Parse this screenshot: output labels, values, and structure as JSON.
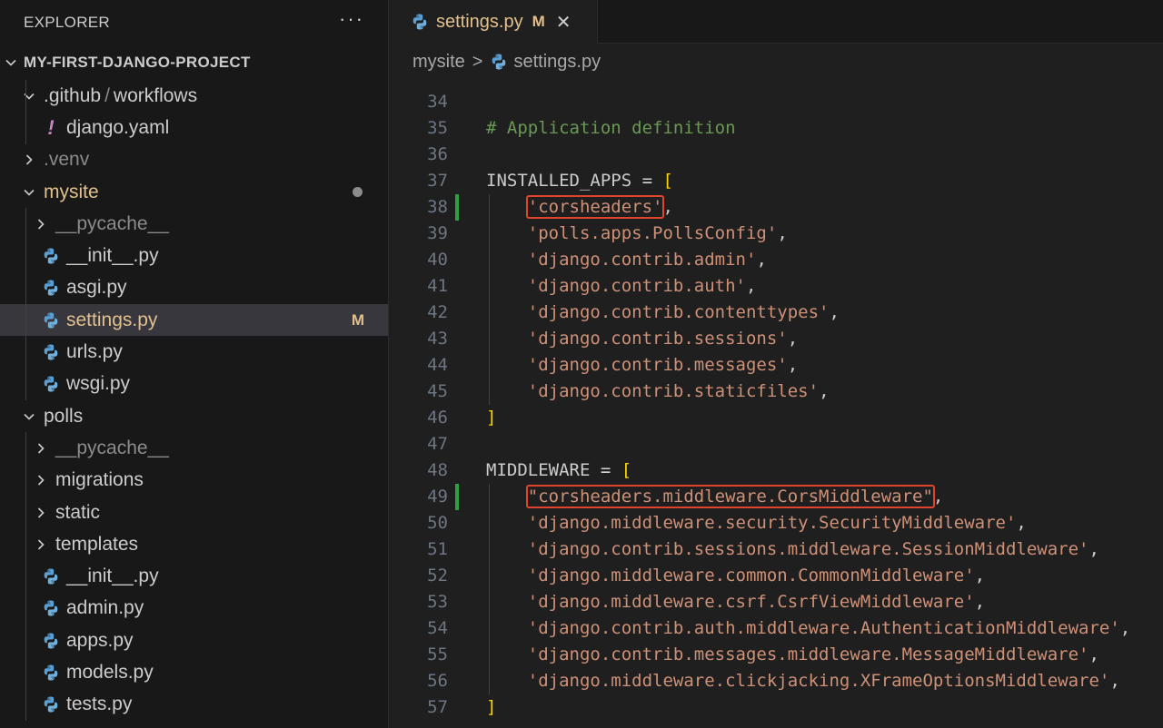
{
  "explorer": {
    "title": "EXPLORER",
    "more": "···",
    "project": "MY-FIRST-DJANGO-PROJECT",
    "tree": [
      {
        "label": "<span data-name='github-folder-label'>.github</span>",
        "kind": "folder",
        "open": true,
        "depth": 0,
        "name": "github-folder",
        "compact": [
          "workflows"
        ]
      },
      {
        "label": "django.yaml",
        "kind": "yaml",
        "depth": 1,
        "name": "django-yaml"
      },
      {
        "label": ".venv",
        "kind": "folder",
        "open": false,
        "depth": 0,
        "name": "venv-folder",
        "dim": true
      },
      {
        "label": "mysite",
        "kind": "folder",
        "open": true,
        "depth": 0,
        "name": "mysite-folder",
        "mod": true,
        "dot": true
      },
      {
        "label": "__pycache__",
        "kind": "folder",
        "open": false,
        "depth": 1,
        "name": "mysite-pycache",
        "dim": true
      },
      {
        "label": "__init__.py",
        "kind": "py",
        "depth": 1,
        "name": "mysite-init"
      },
      {
        "label": "asgi.py",
        "kind": "py",
        "depth": 1,
        "name": "asgi"
      },
      {
        "label": "settings.py",
        "kind": "py",
        "depth": 1,
        "name": "settings",
        "mod": true,
        "badge": "M",
        "selected": true
      },
      {
        "label": "urls.py",
        "kind": "py",
        "depth": 1,
        "name": "urls"
      },
      {
        "label": "wsgi.py",
        "kind": "py",
        "depth": 1,
        "name": "wsgi"
      },
      {
        "label": "polls",
        "kind": "folder",
        "open": true,
        "depth": 0,
        "name": "polls-folder"
      },
      {
        "label": "__pycache__",
        "kind": "folder",
        "open": false,
        "depth": 1,
        "name": "polls-pycache",
        "dim": true
      },
      {
        "label": "migrations",
        "kind": "folder",
        "open": false,
        "depth": 1,
        "name": "migrations"
      },
      {
        "label": "static",
        "kind": "folder",
        "open": false,
        "depth": 1,
        "name": "static"
      },
      {
        "label": "templates",
        "kind": "folder",
        "open": false,
        "depth": 1,
        "name": "templates"
      },
      {
        "label": "__init__.py",
        "kind": "py",
        "depth": 1,
        "name": "polls-init"
      },
      {
        "label": "admin.py",
        "kind": "py",
        "depth": 1,
        "name": "admin"
      },
      {
        "label": "apps.py",
        "kind": "py",
        "depth": 1,
        "name": "apps"
      },
      {
        "label": "models.py",
        "kind": "py",
        "depth": 1,
        "name": "models"
      },
      {
        "label": "tests.py",
        "kind": "py",
        "depth": 1,
        "name": "tests"
      }
    ]
  },
  "tab": {
    "name": "settings.py",
    "modified": "M",
    "close": "✕"
  },
  "breadcrumb": {
    "folder": "mysite",
    "sep": ">",
    "file": "settings.py"
  },
  "code": [
    {
      "n": "34",
      "parts": []
    },
    {
      "n": "35",
      "parts": [
        {
          "t": "# Application definition",
          "c": "cmt"
        }
      ]
    },
    {
      "n": "36",
      "parts": []
    },
    {
      "n": "37",
      "parts": [
        {
          "t": "INSTALLED_APPS ",
          "c": ""
        },
        {
          "t": "= ",
          "c": "op"
        },
        {
          "t": "[",
          "c": "br"
        }
      ]
    },
    {
      "n": "38",
      "added": true,
      "parts": [
        {
          "t": "    ",
          "c": ""
        },
        {
          "t": "'corsheaders'",
          "c": "str",
          "hl": true
        },
        {
          "t": ",",
          "c": ""
        }
      ]
    },
    {
      "n": "39",
      "parts": [
        {
          "t": "    ",
          "c": ""
        },
        {
          "t": "'polls.apps.PollsConfig'",
          "c": "str"
        },
        {
          "t": ",",
          "c": ""
        }
      ]
    },
    {
      "n": "40",
      "parts": [
        {
          "t": "    ",
          "c": ""
        },
        {
          "t": "'django.contrib.admin'",
          "c": "str"
        },
        {
          "t": ",",
          "c": ""
        }
      ]
    },
    {
      "n": "41",
      "parts": [
        {
          "t": "    ",
          "c": ""
        },
        {
          "t": "'django.contrib.auth'",
          "c": "str"
        },
        {
          "t": ",",
          "c": ""
        }
      ]
    },
    {
      "n": "42",
      "parts": [
        {
          "t": "    ",
          "c": ""
        },
        {
          "t": "'django.contrib.contenttypes'",
          "c": "str"
        },
        {
          "t": ",",
          "c": ""
        }
      ]
    },
    {
      "n": "43",
      "parts": [
        {
          "t": "    ",
          "c": ""
        },
        {
          "t": "'django.contrib.sessions'",
          "c": "str"
        },
        {
          "t": ",",
          "c": ""
        }
      ]
    },
    {
      "n": "44",
      "parts": [
        {
          "t": "    ",
          "c": ""
        },
        {
          "t": "'django.contrib.messages'",
          "c": "str"
        },
        {
          "t": ",",
          "c": ""
        }
      ]
    },
    {
      "n": "45",
      "parts": [
        {
          "t": "    ",
          "c": ""
        },
        {
          "t": "'django.contrib.staticfiles'",
          "c": "str"
        },
        {
          "t": ",",
          "c": ""
        }
      ]
    },
    {
      "n": "46",
      "parts": [
        {
          "t": "]",
          "c": "br"
        }
      ]
    },
    {
      "n": "47",
      "parts": []
    },
    {
      "n": "48",
      "parts": [
        {
          "t": "MIDDLEWARE ",
          "c": ""
        },
        {
          "t": "= ",
          "c": "op"
        },
        {
          "t": "[",
          "c": "br"
        }
      ]
    },
    {
      "n": "49",
      "added": true,
      "parts": [
        {
          "t": "    ",
          "c": ""
        },
        {
          "t": "\"corsheaders.middleware.CorsMiddleware\"",
          "c": "str",
          "hl": true
        },
        {
          "t": ",",
          "c": ""
        }
      ]
    },
    {
      "n": "50",
      "parts": [
        {
          "t": "    ",
          "c": ""
        },
        {
          "t": "'django.middleware.security.SecurityMiddleware'",
          "c": "str"
        },
        {
          "t": ",",
          "c": ""
        }
      ]
    },
    {
      "n": "51",
      "parts": [
        {
          "t": "    ",
          "c": ""
        },
        {
          "t": "'django.contrib.sessions.middleware.SessionMiddleware'",
          "c": "str"
        },
        {
          "t": ",",
          "c": ""
        }
      ]
    },
    {
      "n": "52",
      "parts": [
        {
          "t": "    ",
          "c": ""
        },
        {
          "t": "'django.middleware.common.CommonMiddleware'",
          "c": "str"
        },
        {
          "t": ",",
          "c": ""
        }
      ]
    },
    {
      "n": "53",
      "parts": [
        {
          "t": "    ",
          "c": ""
        },
        {
          "t": "'django.middleware.csrf.CsrfViewMiddleware'",
          "c": "str"
        },
        {
          "t": ",",
          "c": ""
        }
      ]
    },
    {
      "n": "54",
      "parts": [
        {
          "t": "    ",
          "c": ""
        },
        {
          "t": "'django.contrib.auth.middleware.AuthenticationMiddleware'",
          "c": "str"
        },
        {
          "t": ",",
          "c": ""
        }
      ]
    },
    {
      "n": "55",
      "parts": [
        {
          "t": "    ",
          "c": ""
        },
        {
          "t": "'django.contrib.messages.middleware.MessageMiddleware'",
          "c": "str"
        },
        {
          "t": ",",
          "c": ""
        }
      ]
    },
    {
      "n": "56",
      "parts": [
        {
          "t": "    ",
          "c": ""
        },
        {
          "t": "'django.middleware.clickjacking.XFrameOptionsMiddleware'",
          "c": "str"
        },
        {
          "t": ",",
          "c": ""
        }
      ]
    },
    {
      "n": "57",
      "parts": [
        {
          "t": "]",
          "c": "br"
        }
      ]
    }
  ]
}
